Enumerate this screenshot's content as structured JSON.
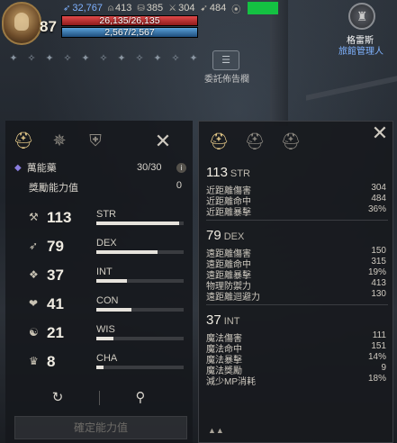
{
  "hud": {
    "level": "87",
    "resources": [
      {
        "icon": "blue-feather-icon",
        "glyph": "➶",
        "value": "32,767",
        "blue": true
      },
      {
        "icon": "helmet-icon",
        "glyph": "⍝",
        "value": "413",
        "blue": false
      },
      {
        "icon": "coin-stack-icon",
        "glyph": "⛁",
        "value": "385",
        "blue": false
      },
      {
        "icon": "sword-icon",
        "glyph": "⚔",
        "value": "304",
        "blue": false
      },
      {
        "icon": "bow-icon",
        "glyph": "➹",
        "value": "484",
        "blue": false
      },
      {
        "icon": "wifi-icon",
        "glyph": "⦿",
        "value": "",
        "blue": false
      }
    ],
    "hp_text": "26,135/26,135",
    "mp_text": "2,567/2,567",
    "buffs": [
      "✦",
      "✧",
      "✦",
      "✧",
      "✦",
      "✧",
      "✦",
      "✧",
      "✦",
      "✧",
      "✦"
    ]
  },
  "npc": {
    "name": "格雷斯",
    "role": "旅館管理人",
    "board_label": "委託佈告欄"
  },
  "left_panel": {
    "tabs": [
      {
        "name": "tab-stats",
        "glyph": "⛑",
        "active": true
      },
      {
        "name": "tab-skills",
        "glyph": "✵",
        "active": false
      },
      {
        "name": "tab-equipment",
        "glyph": "⛨",
        "active": false
      }
    ],
    "elixir_label": "萬能藥",
    "elixir_count": "30/30",
    "bonus_label": "獎勵能力值",
    "bonus_value": "0",
    "stats": [
      {
        "name": "STR",
        "value": "113",
        "glyph": "⚒",
        "fill": 0.95
      },
      {
        "name": "DEX",
        "value": "79",
        "glyph": "➶",
        "fill": 0.7
      },
      {
        "name": "INT",
        "value": "37",
        "glyph": "❖",
        "fill": 0.35
      },
      {
        "name": "CON",
        "value": "41",
        "glyph": "❤",
        "fill": 0.4
      },
      {
        "name": "WIS",
        "value": "21",
        "glyph": "☯",
        "fill": 0.2
      },
      {
        "name": "CHA",
        "value": "8",
        "glyph": "♛",
        "fill": 0.08
      }
    ],
    "confirm_label": "確定能力值"
  },
  "right_panel": {
    "tabs": [
      {
        "name": "tab-helmet-1",
        "glyph": "⛑",
        "active": true
      },
      {
        "name": "tab-helmet-2",
        "glyph": "⛑",
        "active": false
      },
      {
        "name": "tab-helmet-3",
        "glyph": "⛑",
        "active": false
      }
    ],
    "blocks": [
      {
        "value": "113",
        "abbr": "STR",
        "lines": [
          {
            "label": "近距離傷害",
            "value": "304"
          },
          {
            "label": "近距離命中",
            "value": "484"
          },
          {
            "label": "近距離暴擊",
            "value": "36%"
          }
        ]
      },
      {
        "value": "79",
        "abbr": "DEX",
        "lines": [
          {
            "label": "遠距離傷害",
            "value": "150"
          },
          {
            "label": "遠距離命中",
            "value": "315"
          },
          {
            "label": "遠距離暴擊",
            "value": "19%"
          },
          {
            "label": "物理防禦力",
            "value": "413"
          },
          {
            "label": "遠距離迴避力",
            "value": "130"
          }
        ]
      },
      {
        "value": "37",
        "abbr": "INT",
        "lines": [
          {
            "label": "魔法傷害",
            "value": "111"
          },
          {
            "label": "魔法命中",
            "value": "151"
          },
          {
            "label": "魔法暴擊",
            "value": "14%"
          },
          {
            "label": "魔法獎勵",
            "value": "9"
          },
          {
            "label": "減少MP消耗",
            "value": "18%"
          }
        ]
      }
    ]
  }
}
